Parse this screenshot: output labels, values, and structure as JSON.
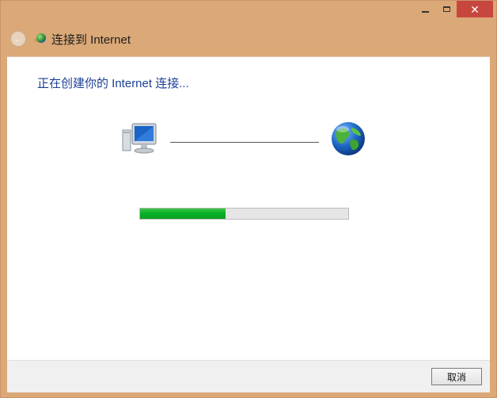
{
  "window": {
    "caption_buttons": {
      "minimize": "–",
      "maximize": "□",
      "close": "✕"
    }
  },
  "header": {
    "back_icon": "back-arrow-icon",
    "app_icon": "network-connection-icon",
    "title": "连接到 Internet"
  },
  "main": {
    "status": "正在创建你的 Internet 连接...",
    "progress_fraction": 0.41,
    "progress_color": "#06b025",
    "left_icon": "computer-icon",
    "right_icon": "globe-icon"
  },
  "footer": {
    "cancel_label": "取消"
  }
}
